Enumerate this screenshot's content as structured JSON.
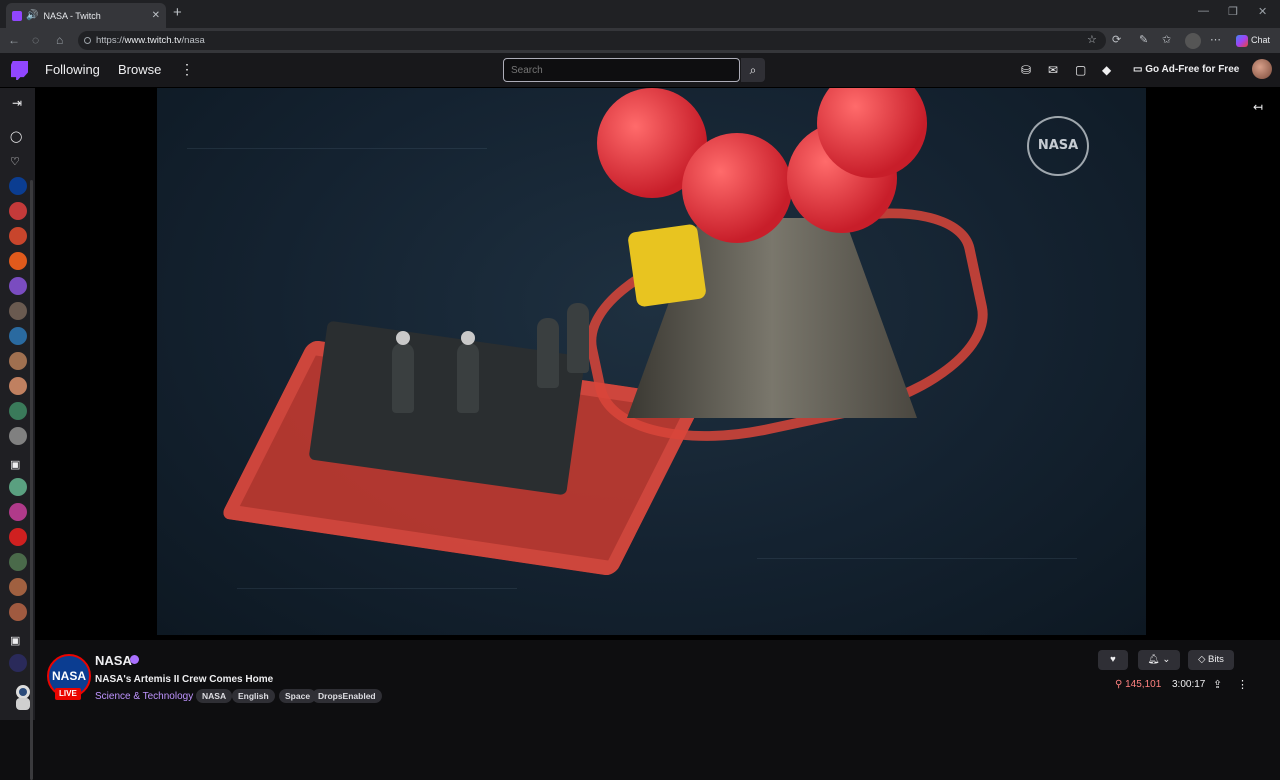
{
  "browser": {
    "tab_title": "NASA - Twitch",
    "url_prefix": "https://",
    "url_host": "www.twitch.tv",
    "url_path": "/nasa",
    "chat_label": "Chat"
  },
  "topnav": {
    "following": "Following",
    "browse": "Browse",
    "search_placeholder": "Search",
    "ad_free": "Go Ad-Free for Free"
  },
  "channel": {
    "name": "NASA",
    "avatar_text": "NASA",
    "live_label": "LIVE",
    "title": "NASA's Artemis II Crew Comes Home",
    "category": "Science & Technology",
    "tags": [
      "NASA",
      "English",
      "Space",
      "DropsEnabled"
    ],
    "viewers": "145,101",
    "uptime": "3:00:17",
    "bits_label": "Bits"
  },
  "video": {
    "watermark": "NASA"
  },
  "colors": {
    "twitch_purple": "#9146ff",
    "live_red": "#eb0400",
    "viewer_red": "#ff8280"
  }
}
